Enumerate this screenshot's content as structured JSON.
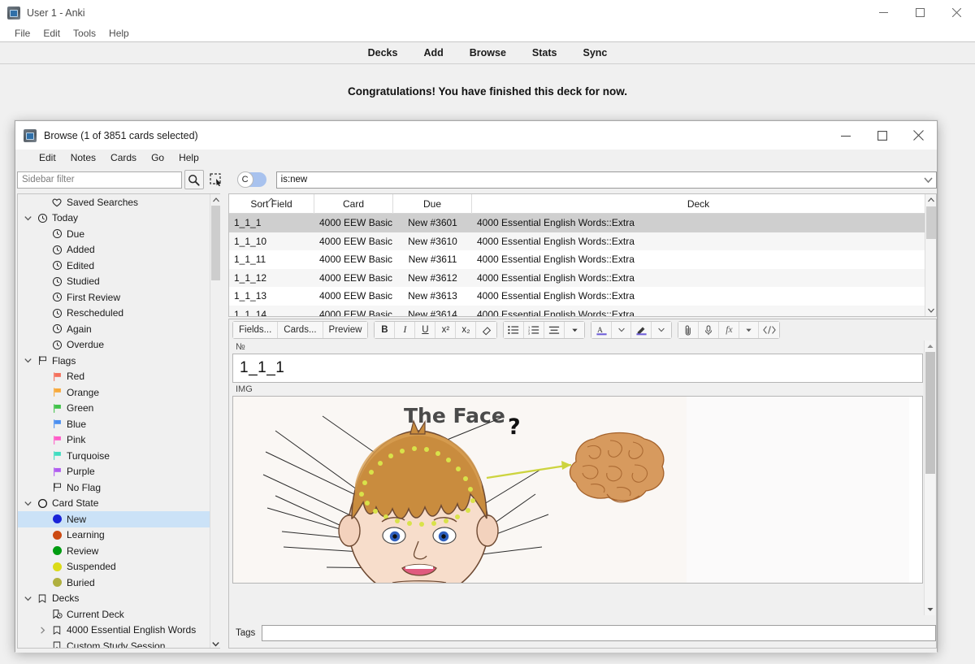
{
  "main_window": {
    "title": "User 1 - Anki",
    "icon": "anki-icon",
    "menus": [
      "File",
      "Edit",
      "Tools",
      "Help"
    ],
    "window_controls": [
      "minimize",
      "maximize",
      "close"
    ],
    "toolbar_links": [
      "Decks",
      "Add",
      "Browse",
      "Stats",
      "Sync"
    ],
    "status_message": "Congratulations! You have finished this deck for now."
  },
  "browse_window": {
    "title": "Browse (1 of 3851 cards selected)",
    "icon": "anki-icon",
    "menus": [
      "Edit",
      "Notes",
      "Cards",
      "Go",
      "Help"
    ],
    "window_controls": [
      "minimize",
      "maximize",
      "close"
    ],
    "search": {
      "sidebar_filter_placeholder": "Sidebar filter",
      "sidebar_filter_value": "",
      "search_icon": "search-icon",
      "select_icon": "selection-tool-icon",
      "toggle_label": "C",
      "toggle_state": "on",
      "query": "is:new",
      "dropdown_icon": "chevron-down-icon"
    },
    "sidebar": {
      "groups": [
        {
          "label": "Saved Searches",
          "icon": "heart-icon",
          "level": 1,
          "twisty": "",
          "selected": false
        },
        {
          "label": "Today",
          "icon": "clock-icon",
          "level": 0,
          "twisty": "down",
          "selected": false
        },
        {
          "label": "Due",
          "icon": "clock-icon",
          "level": 1,
          "selected": false
        },
        {
          "label": "Added",
          "icon": "clock-icon",
          "level": 1,
          "selected": false
        },
        {
          "label": "Edited",
          "icon": "clock-icon",
          "level": 1,
          "selected": false
        },
        {
          "label": "Studied",
          "icon": "clock-icon",
          "level": 1,
          "selected": false
        },
        {
          "label": "First Review",
          "icon": "clock-icon",
          "level": 1,
          "selected": false
        },
        {
          "label": "Rescheduled",
          "icon": "clock-icon",
          "level": 1,
          "selected": false
        },
        {
          "label": "Again",
          "icon": "clock-icon",
          "level": 1,
          "selected": false
        },
        {
          "label": "Overdue",
          "icon": "clock-icon",
          "level": 1,
          "selected": false
        },
        {
          "label": "Flags",
          "icon": "flag-outline-icon",
          "level": 0,
          "twisty": "down",
          "selected": false
        },
        {
          "label": "Red",
          "icon": "flag-icon",
          "color": "#f4705c",
          "level": 1,
          "selected": false
        },
        {
          "label": "Orange",
          "icon": "flag-icon",
          "color": "#f7a93b",
          "level": 1,
          "selected": false
        },
        {
          "label": "Green",
          "icon": "flag-icon",
          "color": "#41c24a",
          "level": 1,
          "selected": false
        },
        {
          "label": "Blue",
          "icon": "flag-icon",
          "color": "#4a8ef0",
          "level": 1,
          "selected": false
        },
        {
          "label": "Pink",
          "icon": "flag-icon",
          "color": "#ff5cc8",
          "level": 1,
          "selected": false
        },
        {
          "label": "Turquoise",
          "icon": "flag-icon",
          "color": "#3fdcc0",
          "level": 1,
          "selected": false
        },
        {
          "label": "Purple",
          "icon": "flag-icon",
          "color": "#b05cf0",
          "level": 1,
          "selected": false
        },
        {
          "label": "No Flag",
          "icon": "flag-outline-icon",
          "level": 1,
          "selected": false
        },
        {
          "label": "Card State",
          "icon": "circle-outline-icon",
          "level": 0,
          "twisty": "down",
          "selected": false
        },
        {
          "label": "New",
          "icon": "dot-icon",
          "color": "#1a24d8",
          "level": 1,
          "selected": true
        },
        {
          "label": "Learning",
          "icon": "dot-icon",
          "color": "#cc4a12",
          "level": 1,
          "selected": false
        },
        {
          "label": "Review",
          "icon": "dot-icon",
          "color": "#009c11",
          "level": 1,
          "selected": false
        },
        {
          "label": "Suspended",
          "icon": "dot-icon",
          "color": "#dbdb18",
          "level": 1,
          "selected": false
        },
        {
          "label": "Buried",
          "icon": "dot-icon",
          "color": "#b0b03f",
          "level": 1,
          "selected": false
        },
        {
          "label": "Decks",
          "icon": "deck-icon",
          "level": 0,
          "twisty": "down",
          "selected": false
        },
        {
          "label": "Current Deck",
          "icon": "deck-clock-icon",
          "level": 1,
          "selected": false
        },
        {
          "label": "4000 Essential English Words",
          "icon": "deck-icon",
          "level": 1,
          "twisty": "right",
          "selected": false
        },
        {
          "label": "Custom Study Session",
          "icon": "deck-icon",
          "level": 1,
          "selected": false
        }
      ]
    },
    "table": {
      "columns": [
        {
          "label": "Sort Field",
          "sorted": true,
          "sort_direction": "asc"
        },
        {
          "label": "Card",
          "sorted": false
        },
        {
          "label": "Due",
          "sorted": false
        },
        {
          "label": "Deck",
          "sorted": false
        }
      ],
      "rows": [
        {
          "sort_field": "1_1_1",
          "card": "4000 EEW Basic",
          "due": "New #3601",
          "deck": "4000 Essential English Words::Extra",
          "selected": true
        },
        {
          "sort_field": "1_1_10",
          "card": "4000 EEW Basic",
          "due": "New #3610",
          "deck": "4000 Essential English Words::Extra",
          "selected": false
        },
        {
          "sort_field": "1_1_11",
          "card": "4000 EEW Basic",
          "due": "New #3611",
          "deck": "4000 Essential English Words::Extra",
          "selected": false
        },
        {
          "sort_field": "1_1_12",
          "card": "4000 EEW Basic",
          "due": "New #3612",
          "deck": "4000 Essential English Words::Extra",
          "selected": false
        },
        {
          "sort_field": "1_1_13",
          "card": "4000 EEW Basic",
          "due": "New #3613",
          "deck": "4000 Essential English Words::Extra",
          "selected": false
        },
        {
          "sort_field": "1_1_14",
          "card": "4000 EEW Basic",
          "due": "New #3614",
          "deck": "4000 Essential English Words::Extra",
          "selected": false
        }
      ]
    },
    "editor": {
      "toolbar": {
        "fields_label": "Fields...",
        "cards_label": "Cards...",
        "preview_label": "Preview",
        "bold_label": "B",
        "italic_label": "I",
        "underline_label": "U",
        "superscript_label": "x²",
        "subscript_label": "x₂",
        "eraser_icon": "remove-formatting-icon",
        "unordered_list_icon": "bullet-list-icon",
        "ordered_list_icon": "numbered-list-icon",
        "align_icon": "align-icon",
        "align_dropdown_icon": "caret-down-icon",
        "text_color_label": "A",
        "text_color": "#6f5fd8",
        "text_color_dropdown_icon": "chevron-down-icon",
        "highlight_icon": "highlighter-icon",
        "highlight_color": "#6f5fd8",
        "highlight_dropdown_icon": "chevron-down-icon",
        "attach_icon": "paperclip-icon",
        "record_icon": "microphone-icon",
        "mathjax_label": "fx",
        "mathjax_dropdown_icon": "caret-down-icon",
        "html_editor_icon": "code-icon"
      },
      "fields": [
        {
          "label": "№",
          "value": "1_1_1",
          "type": "text"
        },
        {
          "label": "IMG",
          "value": "",
          "type": "image",
          "image_title": "The Face",
          "image_marker": "?"
        }
      ],
      "tags_label": "Tags",
      "tags_value": "",
      "tags_placeholder": ""
    }
  },
  "colors": {
    "selection_blue": "#cbe2f7",
    "row_selection": "#cfcfcf",
    "toggle_on": "#a8c2ee",
    "window_bg": "#f0f0f0"
  }
}
